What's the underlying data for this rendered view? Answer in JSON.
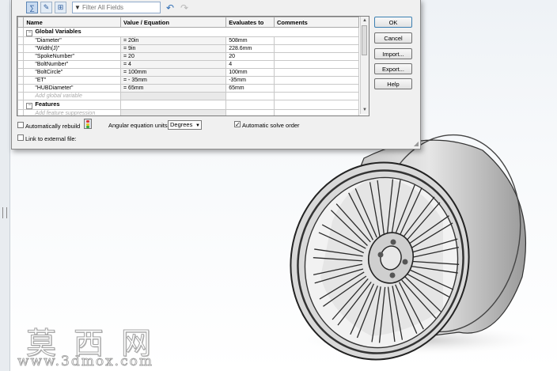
{
  "toolbar": {
    "filter_placeholder": "Filter All Fields"
  },
  "table": {
    "headers": [
      "Name",
      "Value / Equation",
      "Evaluates to",
      "Comments"
    ],
    "groups": [
      {
        "label": "Global Variables",
        "rows": [
          {
            "name": "\"Diameter\"",
            "value": "= 20in",
            "evaluates": "508mm",
            "comment": ""
          },
          {
            "name": "\"Width(J)\"",
            "value": "= 9in",
            "evaluates": "228.6mm",
            "comment": ""
          },
          {
            "name": "\"SpokeNumber\"",
            "value": "= 20",
            "evaluates": "20",
            "comment": ""
          },
          {
            "name": "\"BoltNumber\"",
            "value": "= 4",
            "evaluates": "4",
            "comment": ""
          },
          {
            "name": "\"BoltCircle\"",
            "value": "= 100mm",
            "evaluates": "100mm",
            "comment": ""
          },
          {
            "name": "\"ET\"",
            "value": "= - 35mm",
            "evaluates": "-35mm",
            "comment": ""
          },
          {
            "name": "\"HUBDiameter\"",
            "value": "= 65mm",
            "evaluates": "65mm",
            "comment": ""
          }
        ],
        "add_placeholder": "Add global variable"
      },
      {
        "label": "Features",
        "rows": [],
        "add_placeholder": "Add feature suppression"
      }
    ]
  },
  "buttons": {
    "ok": "OK",
    "cancel": "Cancel",
    "import": "Import...",
    "export": "Export...",
    "help": "Help"
  },
  "options": {
    "auto_rebuild_label": "Automatically rebuild",
    "auto_rebuild_checked": false,
    "angular_units_label": "Angular equation units:",
    "angular_units_value": "Degrees",
    "auto_solve_label": "Automatic solve order",
    "auto_solve_checked": true,
    "link_external_label": "Link to external file:",
    "link_external_checked": false
  },
  "watermark": {
    "chinese": "莫西网",
    "url": "www.3dmox.com"
  },
  "colors": {
    "dialog_bg": "#f0f0f0",
    "wheel_body": "#cfcfcf",
    "accent": "#3c7fb1"
  }
}
